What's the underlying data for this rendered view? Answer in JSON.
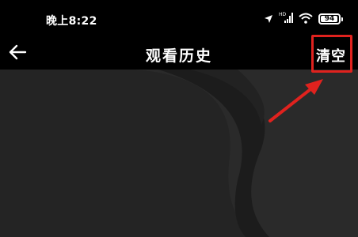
{
  "status_bar": {
    "time": "晚上8:22",
    "battery": "94",
    "battery_level": 0.94,
    "network_label": "HD",
    "icons": [
      "location-arrow-icon",
      "signal-icon",
      "wifi-icon",
      "battery-icon"
    ]
  },
  "header": {
    "back_icon": "back-arrow-icon",
    "title": "观看历史",
    "clear_label": "清空"
  },
  "annotation": {
    "highlight_color": "#e0221e",
    "arrow_color": "#e0221e"
  },
  "colors": {
    "background": "#000000",
    "content": "#242424",
    "text": "#ffffff"
  }
}
